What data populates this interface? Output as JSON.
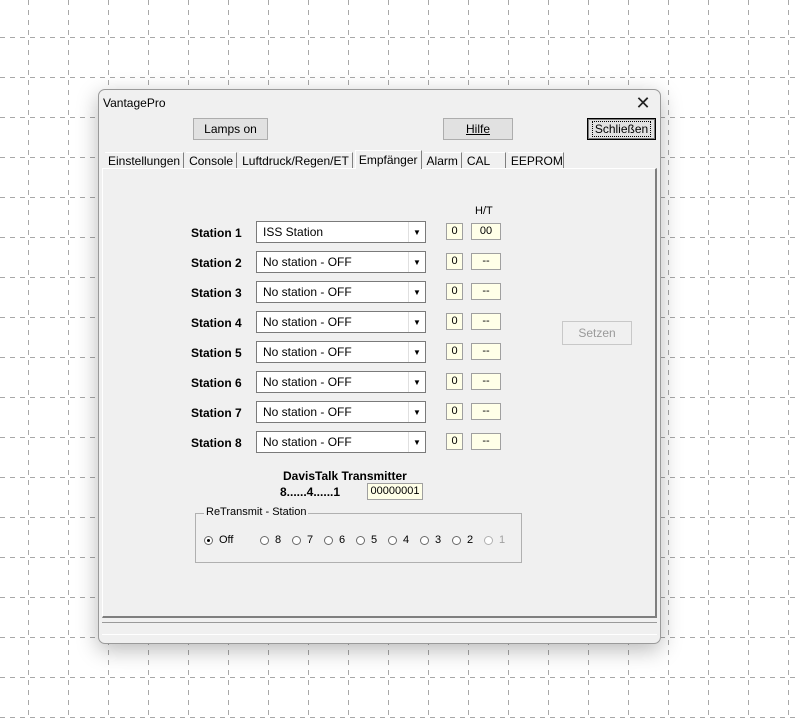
{
  "window": {
    "title": "VantagePro",
    "close_glyph": "✕"
  },
  "toolbar": {
    "lamps_label": "Lamps on",
    "help_label": "Hilfe",
    "close_label": "Schließen"
  },
  "tabs": [
    {
      "label": "Einstellungen",
      "active": false
    },
    {
      "label": "Console",
      "active": false
    },
    {
      "label": "Luftdruck/Regen/ET",
      "active": false
    },
    {
      "label": "Empfänger",
      "active": true
    },
    {
      "label": "Alarm",
      "active": false
    },
    {
      "label": "CAL",
      "active": false
    },
    {
      "label": "EEPROM",
      "active": false
    }
  ],
  "receiver": {
    "ht_header": "H/T",
    "stations": [
      {
        "label": "Station 1",
        "selection": "ISS Station",
        "id": "0",
        "ht": "00"
      },
      {
        "label": "Station 2",
        "selection": "No station - OFF",
        "id": "0",
        "ht": "--"
      },
      {
        "label": "Station 3",
        "selection": "No station - OFF",
        "id": "0",
        "ht": "--"
      },
      {
        "label": "Station 4",
        "selection": "No station - OFF",
        "id": "0",
        "ht": "--"
      },
      {
        "label": "Station 5",
        "selection": "No station - OFF",
        "id": "0",
        "ht": "--"
      },
      {
        "label": "Station 6",
        "selection": "No station - OFF",
        "id": "0",
        "ht": "--"
      },
      {
        "label": "Station 7",
        "selection": "No station - OFF",
        "id": "0",
        "ht": "--"
      },
      {
        "label": "Station 8",
        "selection": "No station - OFF",
        "id": "0",
        "ht": "--"
      }
    ],
    "set_label": "Setzen",
    "davistalk_title": "DavisTalk Transmitter",
    "bit_order": "8......4......1",
    "bit_value": "00000001",
    "retransmit": {
      "title": "ReTransmit - Station",
      "options": [
        {
          "label": "Off",
          "checked": true,
          "disabled": false
        },
        {
          "label": "8",
          "checked": false,
          "disabled": false
        },
        {
          "label": "7",
          "checked": false,
          "disabled": false
        },
        {
          "label": "6",
          "checked": false,
          "disabled": false
        },
        {
          "label": "5",
          "checked": false,
          "disabled": false
        },
        {
          "label": "4",
          "checked": false,
          "disabled": false
        },
        {
          "label": "3",
          "checked": false,
          "disabled": false
        },
        {
          "label": "2",
          "checked": false,
          "disabled": false
        },
        {
          "label": "1",
          "checked": false,
          "disabled": true
        }
      ]
    }
  }
}
